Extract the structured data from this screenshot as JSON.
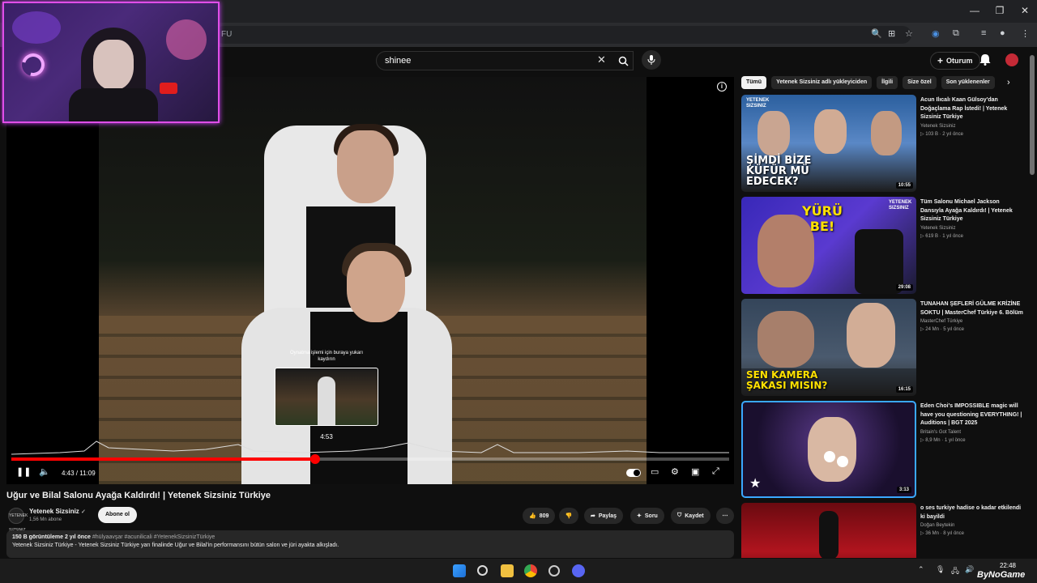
{
  "browser": {
    "address_fragment": "FU",
    "window_controls": [
      "—",
      "❐",
      "✕"
    ]
  },
  "youtube": {
    "search": {
      "value": "shinee"
    },
    "login_label": "Oturum",
    "login_prefix": "+"
  },
  "player": {
    "time_display": "4:43 / 11:09",
    "progress_fraction": 0.423,
    "hover_time": "4:53",
    "hover_note": "Oynatma işlemi için buraya yukarı kaydırın"
  },
  "video": {
    "title": "Uğur ve Bilal Salonu Ayağa Kaldırdı! | Yetenek Sizsiniz Türkiye",
    "channel": "Yetenek Sizsiniz",
    "channel_verified": "✓",
    "channel_avatar_text": "YETENEK SIZSINIZ",
    "subscribers": "1,56 Mn abone",
    "subscribe_label": "Abone ol",
    "likes": "809",
    "share_label": "Paylaş",
    "ask_label": "Soru",
    "save_label": "Kaydet",
    "views": "150 B görüntüleme",
    "age": "2 yıl önce",
    "tags": "#hülyaavşar #acunilicali #YetenekSizsinizTürkiye",
    "description": "Yetenek Sizsiniz Türkiye - Yetenek Sizsiniz Türkiye yarı finalinde Uğur ve Bilal'in performansını bütün salon ve jüri ayakta alkışladı."
  },
  "chips": [
    "Tümü",
    "Yetenek Sizsiniz adlı yükleyiciden",
    "İlgili",
    "Size özel",
    "Son yüklenenler"
  ],
  "recommendations": [
    {
      "title": "Acun Ilıcalı Kaan Gülsoy'dan Doğaçlama Rap İstedi! | Yetenek Sizsiniz Türkiye",
      "channel": "Yetenek Sizsiniz",
      "meta": "▷ 103 B · 2 yıl önce",
      "duration": "10:55",
      "caption": "ŞİMDİ BİZE KÜFÜR MÜ EDECEK?",
      "badge": "YETENEK SIZSINIZ",
      "thumb_bg": "#3a6fb0"
    },
    {
      "title": "Tüm Salonu Michael Jackson Dansıyla Ayağa Kaldırdı! | Yetenek Sizsiniz Türkiye",
      "channel": "Yetenek Sizsiniz",
      "meta": "▷ 619 B · 1 yıl önce",
      "duration": "29:08",
      "caption": "YÜRÜ BE!",
      "badge": "YETENEK SIZSINIZ",
      "thumb_bg": "#3a2fb8"
    },
    {
      "title": "TUNAHAN ŞEFLERİ GÜLME KRİZİNE SOKTU | MasterChef Türkiye 6. Bölüm",
      "channel": "MasterChef Türkiye",
      "meta": "▷ 24 Mn · 5 yıl önce",
      "duration": "16:15",
      "caption": "SEN KAMERA ŞAKASI MISIN?",
      "badge": "",
      "thumb_bg": "#2c3a4a"
    },
    {
      "title": "Eden Choi's IMPOSSIBLE magic will have you questioning EVERYTHING! | Auditions | BGT 2025",
      "channel": "Britain's Got Talent",
      "meta": "▷ 8,9 Mn · 1 yıl önce",
      "duration": "3:13",
      "caption": "",
      "badge": "",
      "thumb_bg": "#2a1a4a"
    },
    {
      "title": "o ses turkiye hadise o kadar etkilendi ki bayildi",
      "channel": "Doğan Beytekin",
      "meta": "▷ 36 Mn · 8 yıl önce",
      "duration": "",
      "caption": "",
      "badge": "",
      "thumb_bg": "#8a0e16"
    }
  ],
  "taskbar": {
    "time": "22:48",
    "watermark": "ByNoGame"
  },
  "colors": {
    "accent_red": "#ff0000",
    "webcam_border": "#e04ee8",
    "bg": "#0f0f0f"
  }
}
